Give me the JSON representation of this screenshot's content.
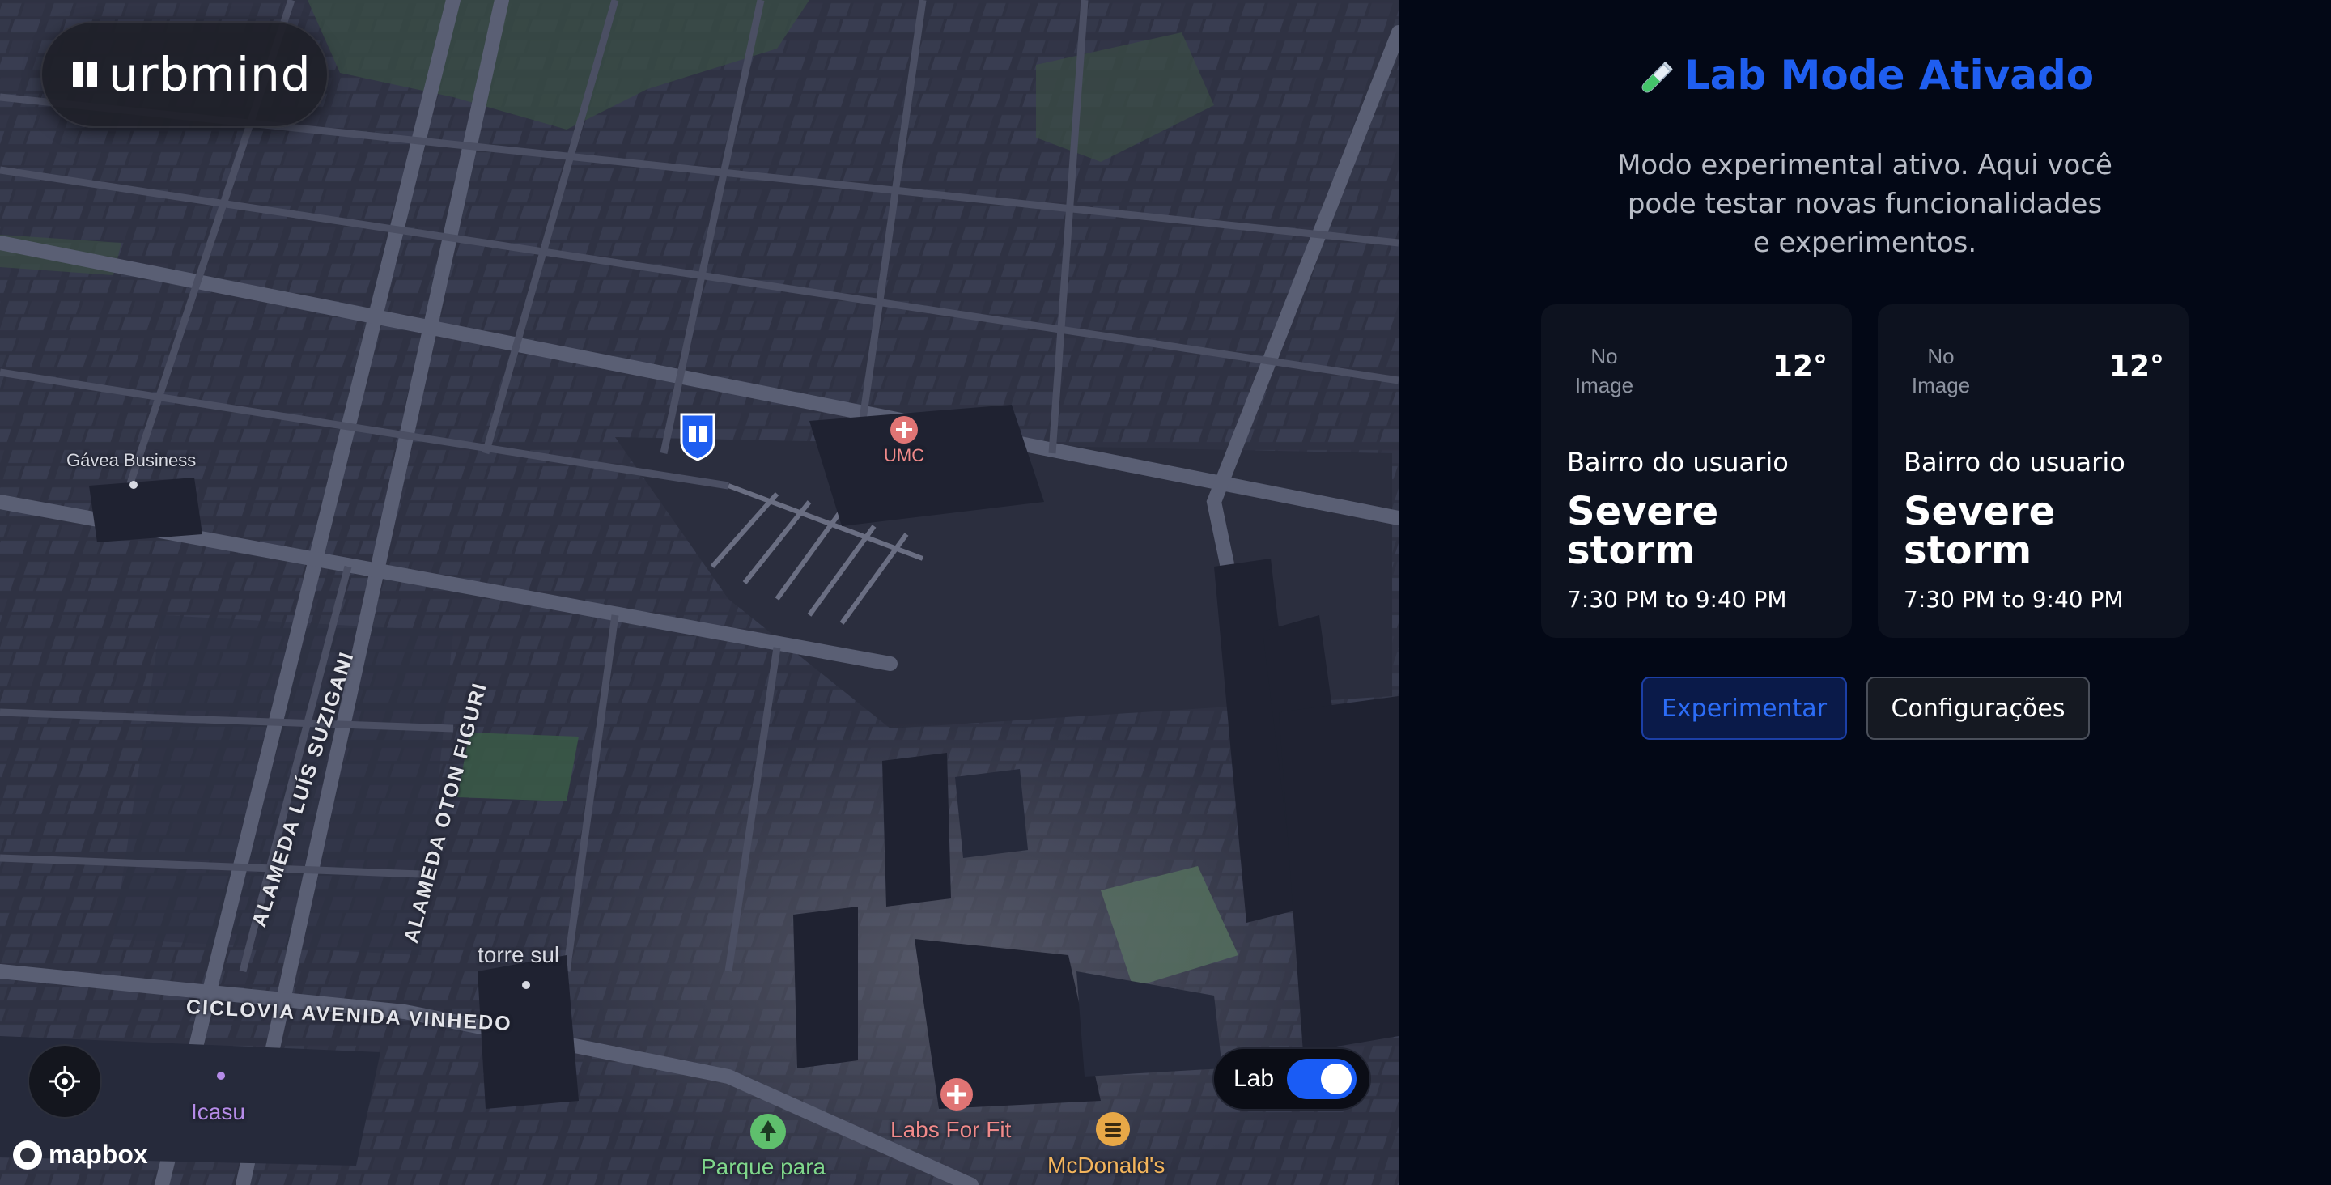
{
  "app": {
    "logo_text": "urbmind"
  },
  "map": {
    "labels": {
      "gavea": "Gávea Business",
      "umc": "UMC",
      "torre": "torre sul",
      "icasu": "Icasu",
      "parque": "Parque para",
      "labs": "Labs For Fit",
      "mcdonalds": "McDonald's"
    },
    "streets": {
      "suzigani": "ALAMEDA LUÍS SUZIGANI",
      "figuri": "ALAMEDA OTON FIGURI",
      "vinhedo": "CICLOVIA AVENIDA VINHEDO"
    },
    "attribution": "mapbox",
    "lab_toggle": {
      "label": "Lab",
      "on": true
    }
  },
  "panel": {
    "title": "Lab Mode Ativado",
    "description": "Modo experimental ativo. Aqui você pode testar novas funcionalidades e experimentos.",
    "cards": [
      {
        "image_placeholder": "No Image",
        "temp": "12°",
        "location": "Bairro do usuario",
        "event": "Severe storm",
        "time": "7:30 PM to 9:40 PM"
      },
      {
        "image_placeholder": "No Image",
        "temp": "12°",
        "location": "Bairro do usuario",
        "event": "Severe storm",
        "time": "7:30 PM to 9:40 PM"
      }
    ],
    "buttons": {
      "primary": "Experimentar",
      "secondary": "Configurações"
    }
  },
  "colors": {
    "accent": "#1f5ef0",
    "toggle": "#1a5cf5",
    "panel_bg": "#030816",
    "map_bg": "#2b2e3e"
  }
}
